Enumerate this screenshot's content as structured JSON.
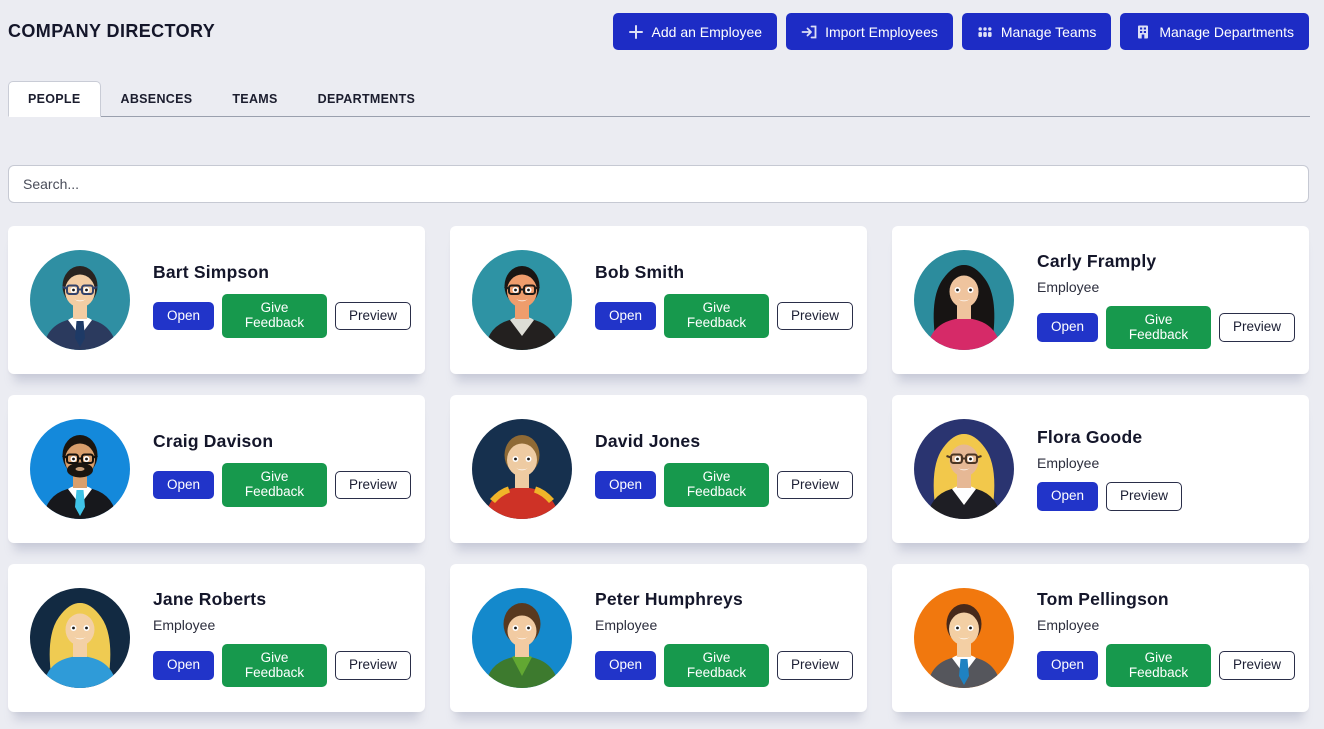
{
  "page": {
    "title": "COMPANY DIRECTORY",
    "background_color": "#ebecf2"
  },
  "header_actions": [
    {
      "id": "add-employee",
      "label": "Add an Employee",
      "icon": "plus-icon"
    },
    {
      "id": "import-employees",
      "label": "Import Employees",
      "icon": "import-icon"
    },
    {
      "id": "manage-teams",
      "label": "Manage Teams",
      "icon": "team-icon"
    },
    {
      "id": "manage-departments",
      "label": "Manage Departments",
      "icon": "building-icon"
    }
  ],
  "tabs": [
    {
      "id": "people",
      "label": "PEOPLE",
      "active": true
    },
    {
      "id": "absences",
      "label": "ABSENCES",
      "active": false
    },
    {
      "id": "teams",
      "label": "TEAMS",
      "active": false
    },
    {
      "id": "departments",
      "label": "DEPARTMENTS",
      "active": false
    }
  ],
  "search": {
    "placeholder": "Search..."
  },
  "card_buttons": {
    "open": "Open",
    "give_feedback": "Give Feedback",
    "preview": "Preview"
  },
  "colors": {
    "header_button": "#1d2cc5",
    "open_button": "#2134c9",
    "feedback_button": "#17994d",
    "preview_border": "#2a2e49",
    "card_background": "#ffffff"
  },
  "employees": [
    {
      "name": "Bart Simpson",
      "role": null,
      "buttons": [
        "open",
        "give_feedback",
        "preview"
      ],
      "avatar": {
        "bg": "#2f8fa3",
        "skin": "#f3cda3",
        "hair": "#2a2420",
        "hairstyle": "short",
        "top": "#2b3a5e",
        "collar": "#ffffff",
        "tie": "#1e3a66",
        "glasses": "#33436b",
        "beard": null,
        "accent": null
      }
    },
    {
      "name": "Bob Smith",
      "role": null,
      "buttons": [
        "open",
        "give_feedback",
        "preview"
      ],
      "avatar": {
        "bg": "#2e93a4",
        "skin": "#ef9d6c",
        "hair": "#191613",
        "hairstyle": "short",
        "top": "#23201f",
        "collar": "#ddddd6",
        "tie": null,
        "glasses": "#1e1b18",
        "beard": null,
        "accent": null
      }
    },
    {
      "name": "Carly Framply",
      "role": "Employee",
      "buttons": [
        "open",
        "give_feedback",
        "preview"
      ],
      "avatar": {
        "bg": "#2c8c9d",
        "skin": "#efc49e",
        "hair": "#171413",
        "hairstyle": "long",
        "top": "#d62a68",
        "collar": null,
        "tie": null,
        "glasses": null,
        "beard": null,
        "accent": null
      }
    },
    {
      "name": "Craig Davison",
      "role": null,
      "buttons": [
        "open",
        "give_feedback",
        "preview"
      ],
      "avatar": {
        "bg": "#1489db",
        "skin": "#d99f6c",
        "hair": "#1b150f",
        "hairstyle": "short",
        "top": "#17181c",
        "collar": "#ffffff",
        "tie": "#3fc4e8",
        "glasses": "#14110d",
        "beard": "#1b150f",
        "accent": null
      }
    },
    {
      "name": "David Jones",
      "role": null,
      "buttons": [
        "open",
        "give_feedback",
        "preview"
      ],
      "avatar": {
        "bg": "#16304e",
        "skin": "#eecba2",
        "hair": "#8f6a35",
        "hairstyle": "short",
        "top": "#ce3226",
        "collar": null,
        "tie": null,
        "glasses": null,
        "beard": null,
        "accent": "#f0b429"
      }
    },
    {
      "name": "Flora Goode",
      "role": "Employee",
      "buttons": [
        "open",
        "preview"
      ],
      "avatar": {
        "bg": "#2a3470",
        "skin": "#e6b895",
        "hair": "#f2c84b",
        "hairstyle": "long",
        "top": "#1e1e24",
        "collar": "#ffffff",
        "tie": null,
        "glasses": "#4a3524",
        "beard": null,
        "accent": null
      }
    },
    {
      "name": "Jane Roberts",
      "role": "Employee",
      "buttons": [
        "open",
        "give_feedback",
        "preview"
      ],
      "avatar": {
        "bg": "#122a42",
        "skin": "#f3d0a6",
        "hair": "#efcb52",
        "hairstyle": "long",
        "top": "#2f9bd8",
        "collar": null,
        "tie": null,
        "glasses": null,
        "beard": null,
        "accent": null
      }
    },
    {
      "name": "Peter Humphreys",
      "role": "Employee",
      "buttons": [
        "open",
        "give_feedback",
        "preview"
      ],
      "avatar": {
        "bg": "#1489cc",
        "skin": "#f2cba2",
        "hair": "#59391f",
        "hairstyle": "bowl",
        "top": "#3d7a2e",
        "collar": "#62a832",
        "tie": null,
        "glasses": null,
        "beard": null,
        "accent": null
      }
    },
    {
      "name": "Tom Pellingson",
      "role": "Employee",
      "buttons": [
        "open",
        "give_feedback",
        "preview"
      ],
      "avatar": {
        "bg": "#f1780e",
        "skin": "#f3cfa4",
        "hair": "#47291a",
        "hairstyle": "short",
        "top": "#55565c",
        "collar": "#ffffff",
        "tie": "#1f82c2",
        "glasses": null,
        "beard": null,
        "accent": null
      }
    }
  ]
}
